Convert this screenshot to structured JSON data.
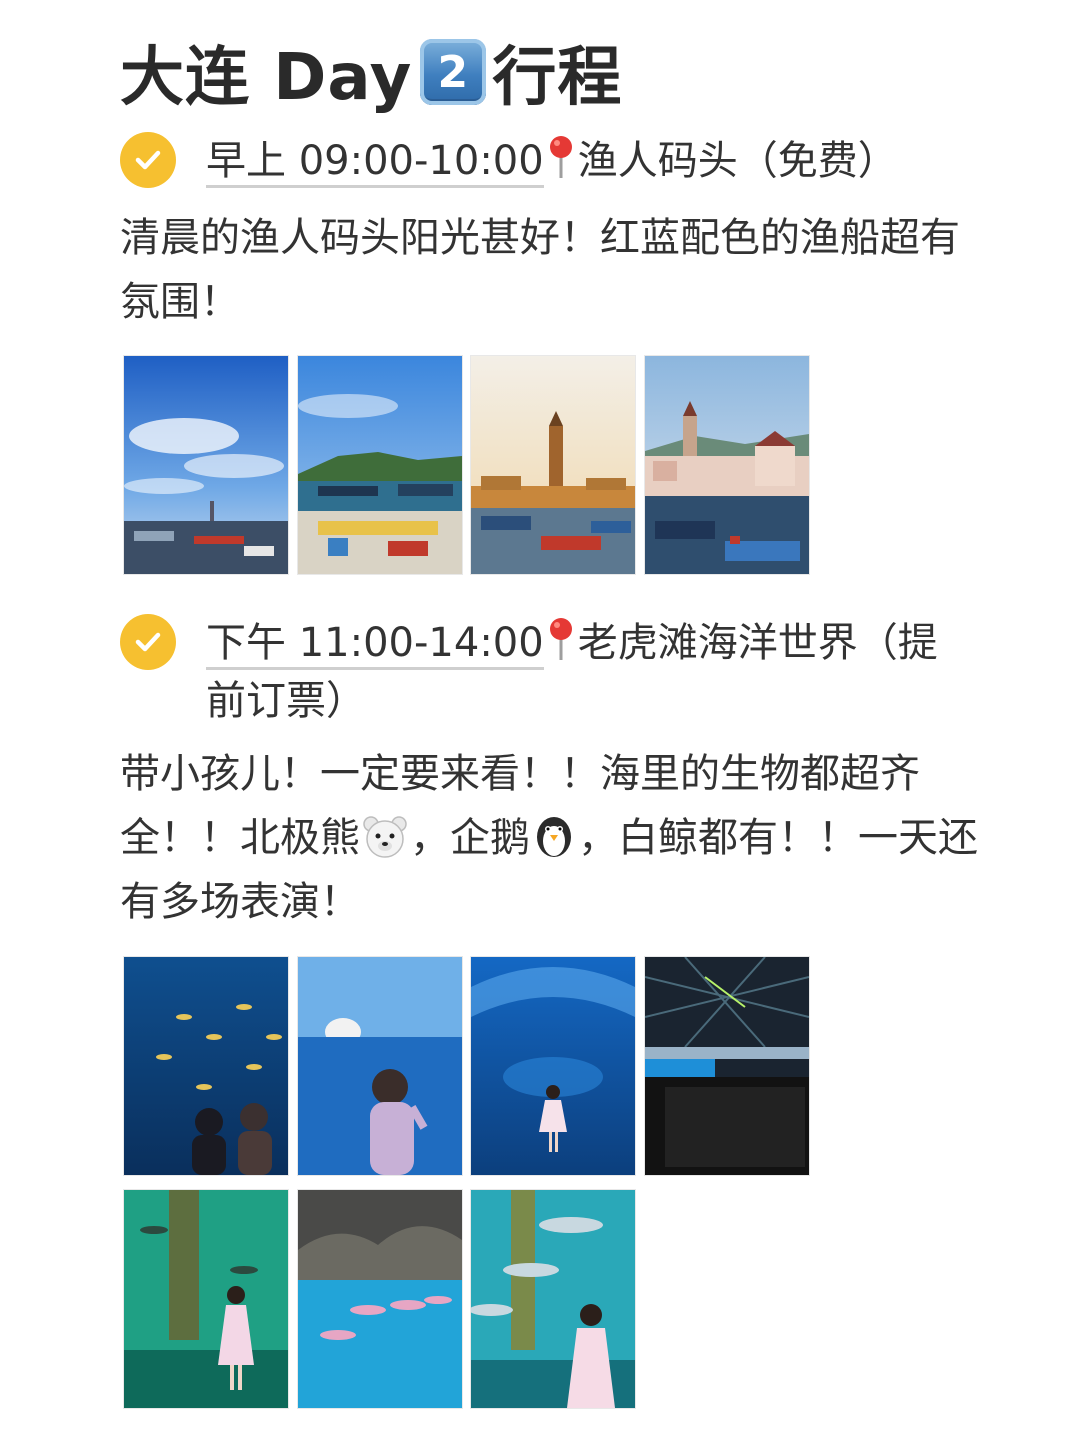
{
  "title": {
    "text_before": "大连 Day",
    "keycap_number": "2",
    "text_after": "行程"
  },
  "sections": [
    {
      "time": "早上 09:00-10:00",
      "place": "渔人码头（免费）",
      "description": "清晨的渔人码头阳光甚好！红蓝配色的渔船超有氛围！",
      "photos": [
        "fishing-harbor-sky-photo",
        "harbor-boats-mountain-photo",
        "lighthouse-sunset-photo",
        "castle-harbor-boats-photo"
      ]
    },
    {
      "time": "下午 11:00-14:00",
      "place": "老虎滩海洋世界（提前订票）",
      "description_part1": "带小孩儿！一定要来看！！海里的生物都超齐全！！北极熊",
      "description_part2": "，企鹅",
      "description_part3": "，白鲸都有！！一天还有多场表演！",
      "photos": [
        "aquarium-fish-tank-photo",
        "polar-bear-tank-photo",
        "aquarium-tunnel-girl-photo",
        "show-arena-audience-photo",
        "green-tank-girl-photo",
        "dolphin-pool-photo",
        "fish-tank-girl-photo"
      ]
    }
  ],
  "icons": {
    "check": "check-circle-icon",
    "pin": "location-pin-icon",
    "polar_bear": "polar-bear-emoji",
    "penguin": "penguin-emoji"
  },
  "colors": {
    "check_yellow": "#f6c030",
    "pin_red": "#e53935",
    "keycap_blue": "#3f7fbf"
  }
}
